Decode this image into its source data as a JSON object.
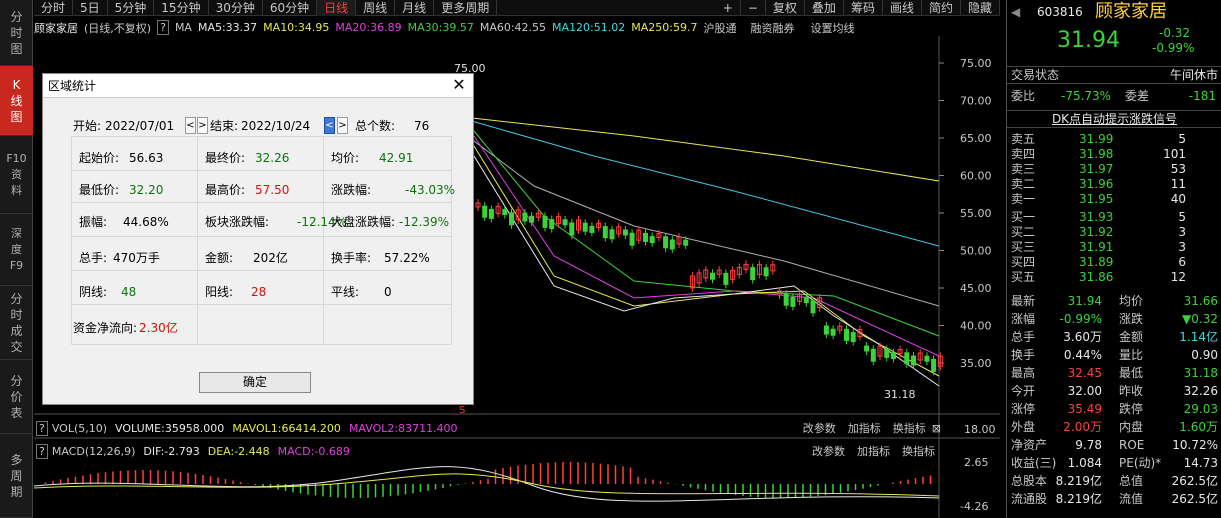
{
  "sidebar": {
    "tabs": [
      "分时图",
      "K线图",
      "F10资料",
      "深度F9",
      "分时成交",
      "分价表",
      "多周期"
    ]
  },
  "topbar": {
    "periods": [
      "分时",
      "5日",
      "5分钟",
      "15分钟",
      "30分钟",
      "60分钟",
      "日线",
      "周线",
      "月线",
      "更多周期"
    ],
    "tools": [
      "+",
      "−",
      "复权",
      "叠加",
      "筹码",
      "画线",
      "简约",
      "隐藏"
    ]
  },
  "ma": {
    "name": "顾家家居",
    "mode": "(日线,不复权)",
    "q": "?",
    "ma": "MA",
    "ma5": "MA5:33.37",
    "ma10": "MA10:34.95",
    "ma20": "MA20:36.89",
    "ma30": "MA30:39.57",
    "ma60": "MA60:42.55",
    "ma120": "MA120:51.02",
    "ma250": "MA250:59.7",
    "hgt": "沪股通",
    "rzrq": "融资融券",
    "setma": "设置均线"
  },
  "price_axis": [
    "75.00",
    "70.00",
    "65.00",
    "60.00",
    "55.00",
    "50.00",
    "45.00",
    "40.00",
    "35.00"
  ],
  "marks": {
    "high": "75.00",
    "low": "31.18",
    "s": "S"
  },
  "vol": {
    "q": "?",
    "name": "VOL(5,10)",
    "volume": "VOLUME:35958.000",
    "mavol1": "MAVOL1:66414.200",
    "mavol2": "MAVOL2:83711.400",
    "p1": "改参数",
    "p2": "加指标",
    "p3": "换指标",
    "axis": "18.00"
  },
  "macd": {
    "q": "?",
    "name": "MACD(12,26,9)",
    "dif": "DIF:-2.793",
    "dea": "DEA:-2.448",
    "macd": "MACD:-0.689",
    "p1": "改参数",
    "p2": "加指标",
    "p3": "换指标",
    "axis_hi": "2.65",
    "axis_lo": "-4.26"
  },
  "dialog": {
    "title": "区域统计",
    "start_label": "开始:",
    "start": "2022/07/01",
    "end_label": "结束:",
    "end": "2022/10/24",
    "count_label": "总个数:",
    "count": "76",
    "r1": [
      [
        "起始价:",
        "56.63"
      ],
      [
        "最终价:",
        "32.26"
      ],
      [
        "均价:",
        "42.91"
      ]
    ],
    "r2": [
      [
        "最低价:",
        "32.20"
      ],
      [
        "最高价:",
        "57.50"
      ],
      [
        "涨跌幅:",
        "-43.03%"
      ]
    ],
    "r3": [
      [
        "振幅:",
        "44.68%"
      ],
      [
        "板块涨跌幅:",
        "-12.14%"
      ],
      [
        "大盘涨跌幅:",
        "-12.39%"
      ]
    ],
    "r4": [
      [
        "总手:",
        "470万手"
      ],
      [
        "金额:",
        "202亿"
      ],
      [
        "换手率:",
        "57.22%"
      ]
    ],
    "r5": [
      [
        "阴线:",
        "48"
      ],
      [
        "阳线:",
        "28"
      ],
      [
        "平线:",
        "0"
      ]
    ],
    "flow_label": "资金净流向:",
    "flow": "2.30亿",
    "ok": "确定"
  },
  "quote": {
    "code": "603816",
    "name": "顾家家居",
    "price": "31.94",
    "chg": "-0.32",
    "pct": "-0.99%",
    "status_label": "交易状态",
    "status": "午间休市",
    "wb_label": "委比",
    "wb": "-75.73%",
    "wc_label": "委差",
    "wc": "-181",
    "dk": "DK点自动提示涨跌信号",
    "asks": [
      [
        "卖五",
        "31.99",
        "5"
      ],
      [
        "卖四",
        "31.98",
        "101"
      ],
      [
        "卖三",
        "31.97",
        "53"
      ],
      [
        "卖二",
        "31.96",
        "11"
      ],
      [
        "卖一",
        "31.95",
        "40"
      ]
    ],
    "bids": [
      [
        "买一",
        "31.93",
        "5"
      ],
      [
        "买二",
        "31.92",
        "3"
      ],
      [
        "买三",
        "31.91",
        "3"
      ],
      [
        "买四",
        "31.89",
        "6"
      ],
      [
        "买五",
        "31.86",
        "12"
      ]
    ],
    "stats": [
      [
        "最新",
        "31.94",
        "均价",
        "31.66"
      ],
      [
        "涨幅",
        "-0.99%",
        "涨跌",
        "▼0.32"
      ],
      [
        "总手",
        "3.60万",
        "金额",
        "1.14亿"
      ],
      [
        "换手",
        "0.44%",
        "量比",
        "0.90"
      ],
      [
        "最高",
        "32.45",
        "最低",
        "31.18"
      ],
      [
        "今开",
        "32.00",
        "昨收",
        "32.26"
      ],
      [
        "涨停",
        "35.49",
        "跌停",
        "29.03"
      ],
      [
        "外盘",
        "2.00万",
        "内盘",
        "1.60万"
      ],
      [
        "净资产",
        "9.78",
        "ROE",
        "10.72%"
      ],
      [
        "收益(三)",
        "1.084",
        "PE(动)*",
        "14.73"
      ],
      [
        "总股本",
        "8.219亿",
        "总值",
        "262.5亿"
      ],
      [
        "流通股",
        "8.219亿",
        "流值",
        "262.5亿"
      ]
    ]
  },
  "colors": {
    "up": "#ff4040",
    "down": "#3cd23c",
    "ma5": "#e8e8e8",
    "ma10": "#e8e850",
    "ma20": "#e040e0",
    "ma30": "#3cd23c",
    "ma60": "#b0b0b0",
    "ma120": "#40c8e8",
    "ma250": "#e8e850"
  }
}
